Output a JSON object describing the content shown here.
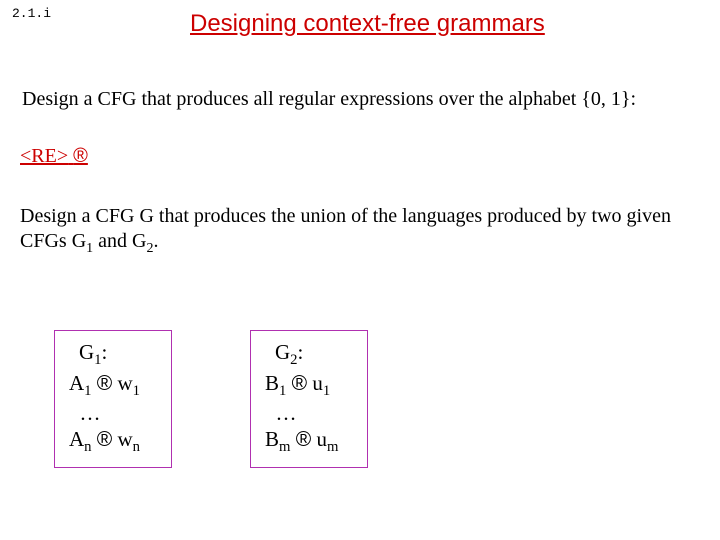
{
  "slide_number": "2.1.i",
  "title": "Designing context-free grammars",
  "para1": "Design a CFG that produces all regular expressions over the alphabet {0, 1}:",
  "re_prefix": "<RE>",
  "re_arrow": "®",
  "para2_a": "Design a CFG  G that produces the union of the languages produced by two given CFGs G",
  "para2_b": " and G",
  "para2_c": ".",
  "g1": {
    "name": "G",
    "name_sub": "1",
    "r1_lhs": "A",
    "r1_lhs_sub": "1",
    "r1_rhs": "w",
    "r1_rhs_sub": "1",
    "dots": "…",
    "rn_lhs": "A",
    "rn_lhs_sub": "n",
    "rn_rhs": "w",
    "rn_rhs_sub": "n"
  },
  "g2": {
    "name": "G",
    "name_sub": "2",
    "r1_lhs": "B",
    "r1_lhs_sub": "1",
    "r1_rhs": "u",
    "r1_rhs_sub": "1",
    "dots": "…",
    "rn_lhs": "B",
    "rn_lhs_sub": "m",
    "rn_rhs": "u",
    "rn_rhs_sub": "m"
  },
  "arrow": "®"
}
